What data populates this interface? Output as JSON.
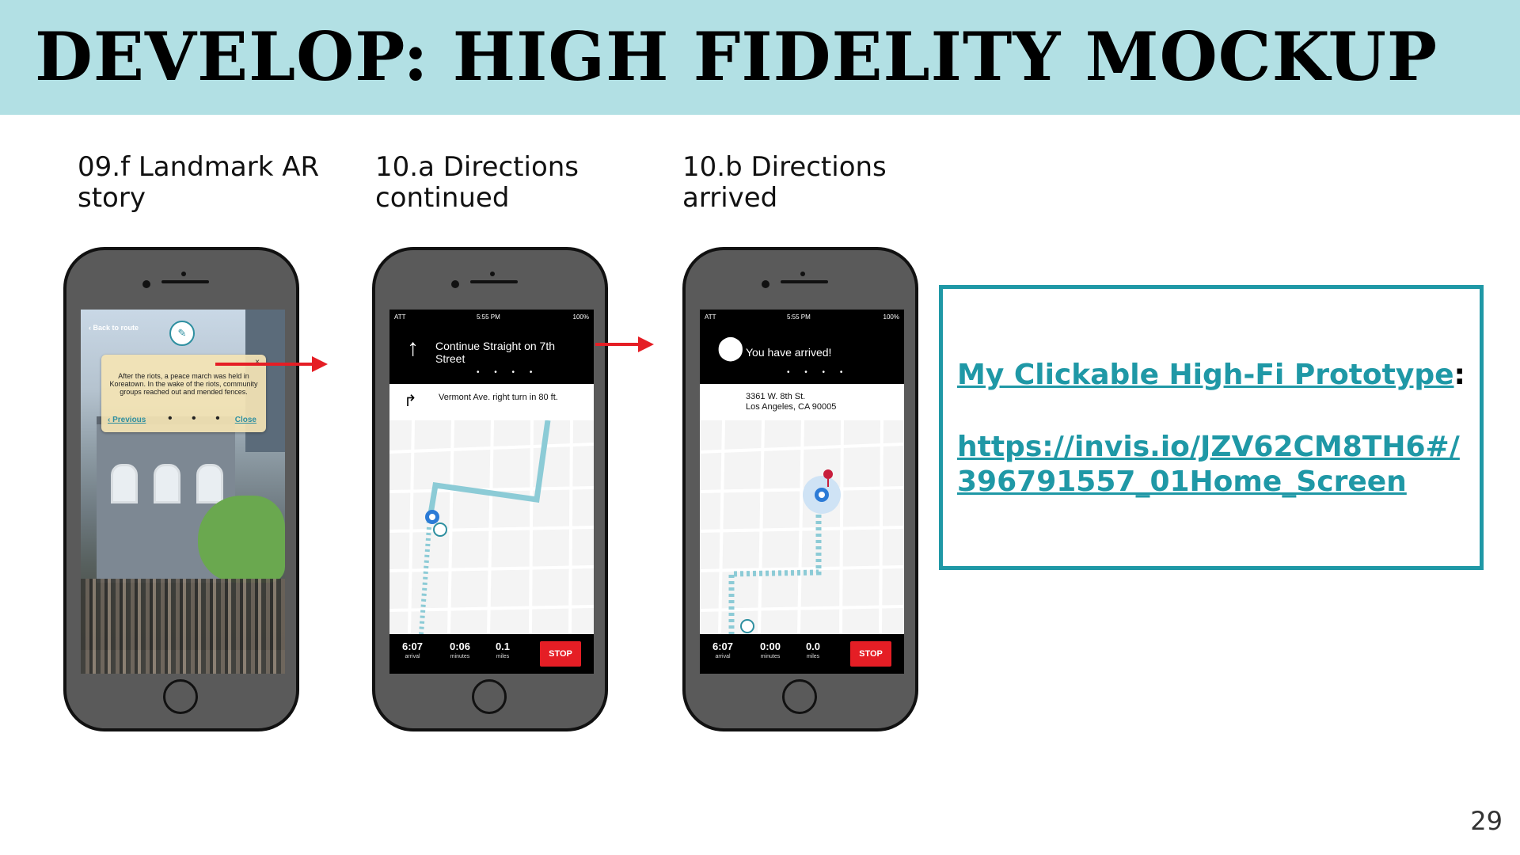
{
  "slide": {
    "title": "DEVELOP: HIGH FIDELITY MOCKUP",
    "page_number": "29",
    "colors": {
      "header_band": "#b2e0e4",
      "accent_teal": "#1f98a6",
      "stop_red": "#e51e25"
    }
  },
  "captions": [
    {
      "line1": "09.f Landmark AR",
      "line2": "story"
    },
    {
      "line1": "10.a Directions",
      "line2": "continued"
    },
    {
      "line1": "10.b Directions",
      "line2": "arrived"
    }
  ],
  "phone1": {
    "back_label": "Back to route",
    "story_text": "After the riots, a peace march was held in Koreatown. In the wake of the riots, community groups reached out and mended fences.",
    "prev_label": "‹ Previous",
    "close_label": "Close",
    "close_x": "×",
    "dots": "• • •"
  },
  "phone2": {
    "status_left": "ATT",
    "status_time": "5:55 PM",
    "status_right": "100%",
    "instruction": "Continue Straight on 7th Street",
    "next_turn": "Vermont Ave. right turn in 80 ft.",
    "dots": "• • • •",
    "arrival_val": "6:07",
    "arrival_lbl": "arrival",
    "minutes_val": "0:06",
    "minutes_lbl": "minutes",
    "miles_val": "0.1",
    "miles_lbl": "miles",
    "stop_label": "STOP"
  },
  "phone3": {
    "status_left": "ATT",
    "status_time": "5:55 PM",
    "status_right": "100%",
    "instruction": "You have arrived!",
    "address_line1": "3361 W. 8th St.",
    "address_line2": "Los Angeles, CA 90005",
    "dots": "• • • •",
    "arrival_val": "6:07",
    "arrival_lbl": "arrival",
    "minutes_val": "0:00",
    "minutes_lbl": "minutes",
    "miles_val": "0.0",
    "miles_lbl": "miles",
    "stop_label": "STOP"
  },
  "prototype_link": {
    "title": "My Clickable High-Fi Prototype",
    "colon": ":",
    "url": "https://invis.io/JZV62CM8TH6#/396791557_01Home_Screen"
  }
}
